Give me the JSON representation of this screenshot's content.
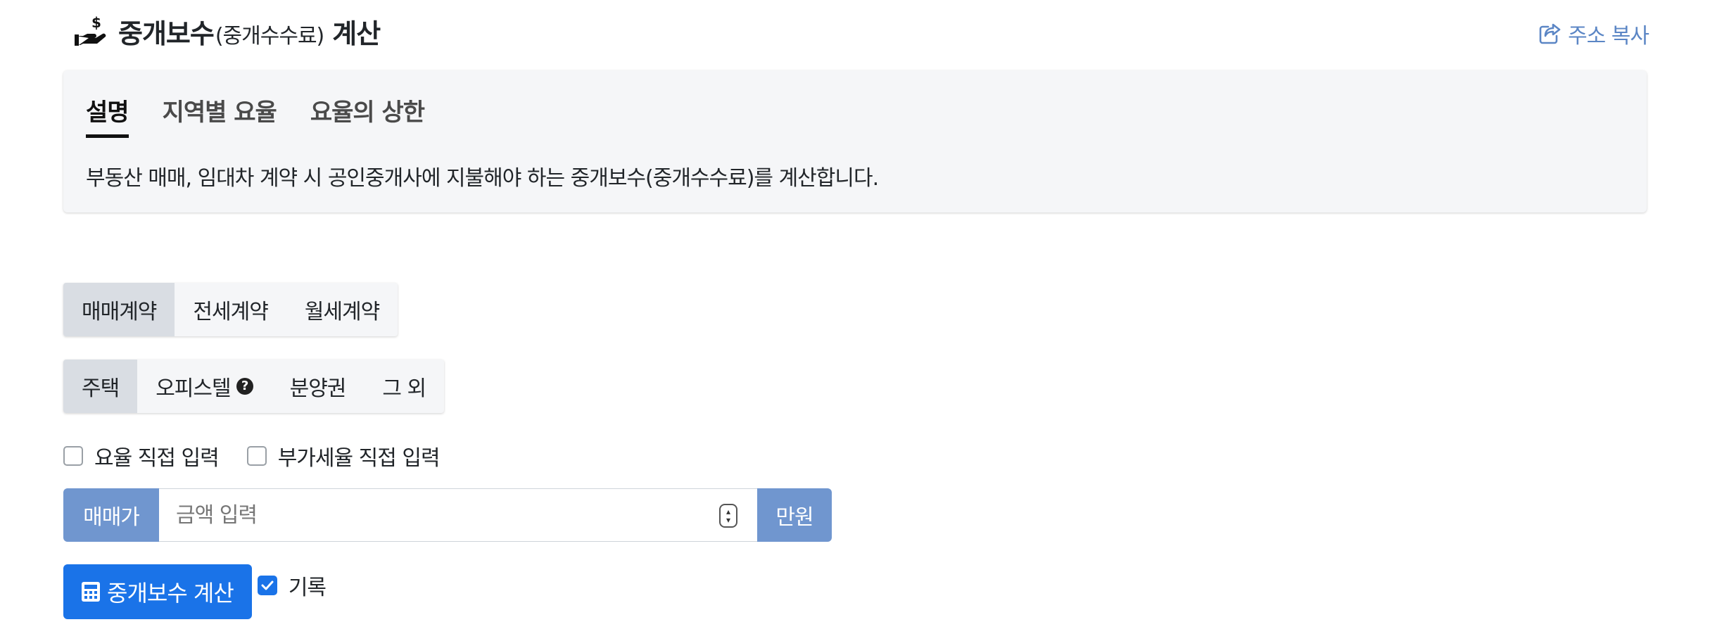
{
  "header": {
    "title_main": "중개보수",
    "title_paren": "(중개수수료)",
    "title_suffix": "계산",
    "copy_link": "주소 복사"
  },
  "info": {
    "tabs": [
      {
        "label": "설명",
        "active": true
      },
      {
        "label": "지역별 요율",
        "active": false
      },
      {
        "label": "요율의 상한",
        "active": false
      }
    ],
    "description": "부동산 매매, 임대차 계약 시 공인중개사에 지불해야 하는 중개보수(중개수수료)를 계산합니다."
  },
  "contract_types": {
    "items": [
      {
        "label": "매매계약",
        "active": true
      },
      {
        "label": "전세계약",
        "active": false
      },
      {
        "label": "월세계약",
        "active": false
      }
    ]
  },
  "property_types": {
    "items": [
      {
        "label": "주택",
        "active": true
      },
      {
        "label": "오피스텔",
        "active": false,
        "help": true
      },
      {
        "label": "분양권",
        "active": false
      },
      {
        "label": "그 외",
        "active": false
      }
    ]
  },
  "options": {
    "rate_manual": {
      "label": "요율 직접 입력",
      "checked": false
    },
    "vat_manual": {
      "label": "부가세율 직접 입력",
      "checked": false
    }
  },
  "price_input": {
    "prefix": "매매가",
    "placeholder": "금액 입력",
    "value": "",
    "suffix": "만원"
  },
  "submit": {
    "button_label": "중개보수 계산",
    "record": {
      "label": "기록",
      "checked": true
    }
  },
  "colors": {
    "accent": "#1a73e8",
    "addon": "#7096cf",
    "link": "#5b86c5",
    "card_bg": "#f5f6f8"
  },
  "icons": {
    "title": "hand-coin-icon",
    "copy": "share-icon",
    "help": "question-circle-icon",
    "calc": "calculator-icon"
  }
}
